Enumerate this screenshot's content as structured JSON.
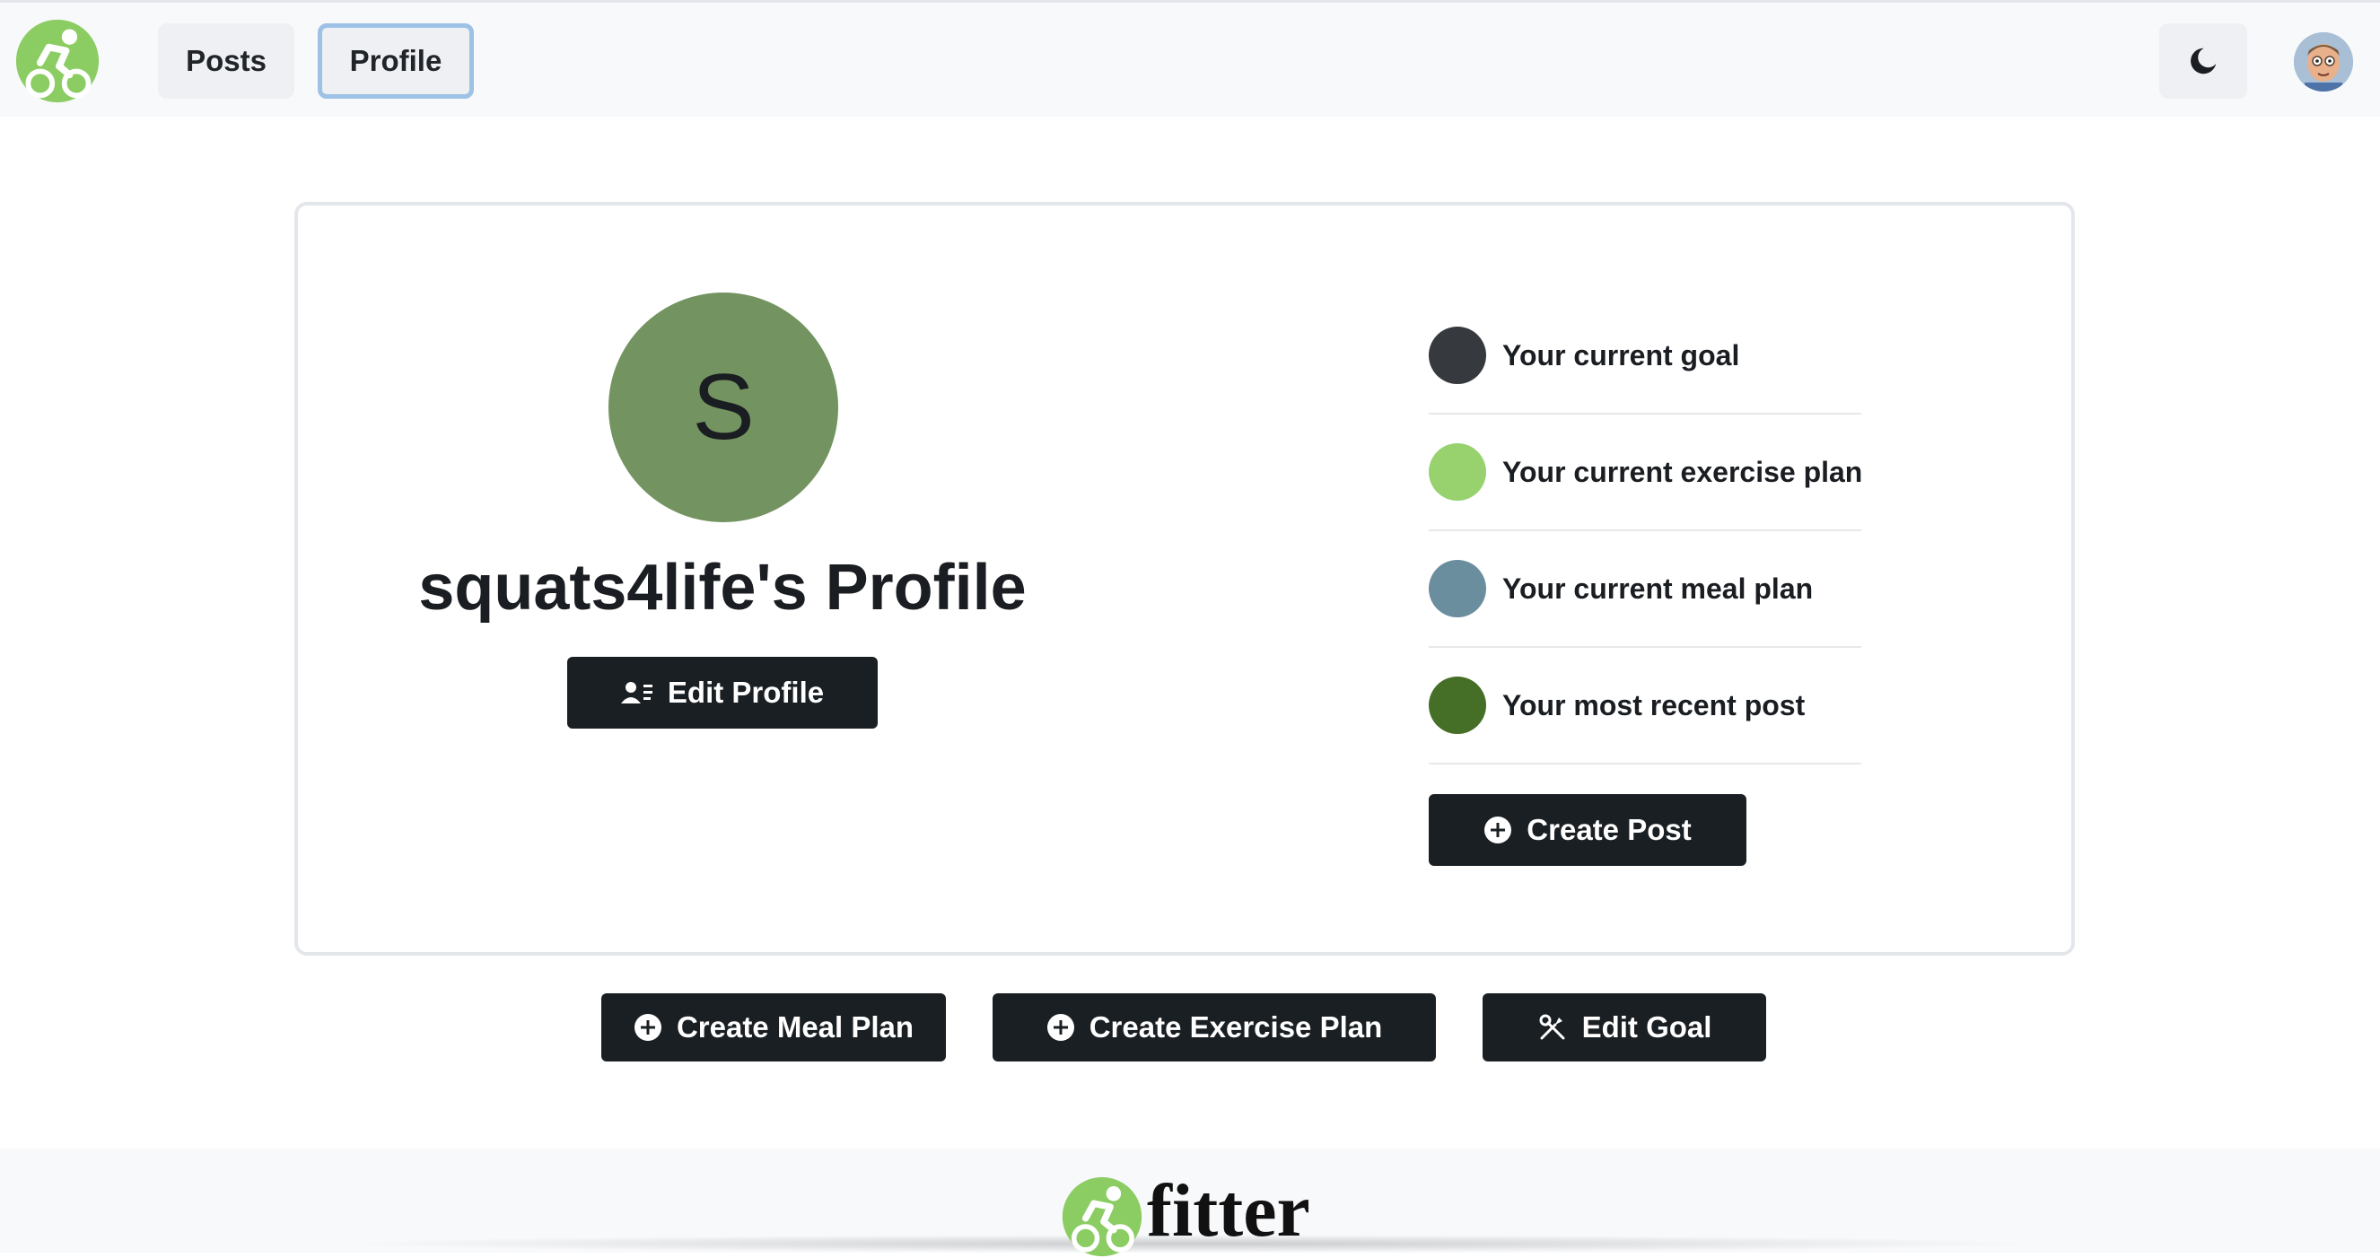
{
  "nav": {
    "posts_label": "Posts",
    "profile_label": "Profile",
    "active_tab": "Profile"
  },
  "header": {
    "theme_icon": "moon-icon",
    "avatar_icon": "user-avatar"
  },
  "profile": {
    "initial": "S",
    "title": "squats4life's Profile",
    "avatar_color": "#739360",
    "edit_button_label": "Edit Profile"
  },
  "summary_items": [
    {
      "label": "Your current goal",
      "color": "#36393d"
    },
    {
      "label": "Your current exercise plan",
      "color": "#98d26e"
    },
    {
      "label": "Your current meal plan",
      "color": "#6b8e9f"
    },
    {
      "label": "Your most recent post",
      "color": "#456e27"
    }
  ],
  "actions": {
    "create_post_label": "Create Post",
    "create_meal_plan_label": "Create Meal Plan",
    "create_exercise_plan_label": "Create Exercise Plan",
    "edit_goal_label": "Edit Goal"
  },
  "footer": {
    "brand": "fitter"
  },
  "colors": {
    "brand_green": "#8ccd63",
    "button_dark": "#1a1f23",
    "active_outline": "#9ec1e6"
  }
}
